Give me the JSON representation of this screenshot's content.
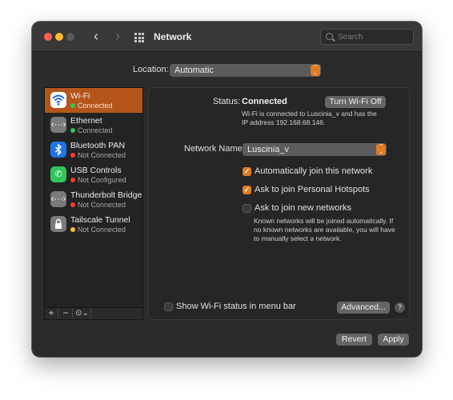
{
  "titlebar": {
    "title": "Network",
    "search_placeholder": "Search"
  },
  "location": {
    "label": "Location:",
    "value": "Automatic"
  },
  "services": [
    {
      "name": "Wi-Fi",
      "status": "Connected",
      "status_color": "#30c75a",
      "icon": "wifi-icon",
      "icon_bg": "#1f6fe0"
    },
    {
      "name": "Ethernet",
      "status": "Connected",
      "status_color": "#30c75a",
      "icon": "ethernet-icon",
      "icon_bg": "#7a7a7a"
    },
    {
      "name": "Bluetooth PAN",
      "status": "Not Connected",
      "status_color": "#ff3b30",
      "icon": "bluetooth-icon",
      "icon_bg": "#1e74e8"
    },
    {
      "name": "USB Controls",
      "status": "Not Configured",
      "status_color": "#ff3b30",
      "icon": "phone-icon",
      "icon_bg": "#2ec55a"
    },
    {
      "name": "Thunderbolt Bridge",
      "status": "Not Connected",
      "status_color": "#ff3b30",
      "icon": "thunderbolt-bridge-icon",
      "icon_bg": "#7a7a7a"
    },
    {
      "name": "Tailscale Tunnel",
      "status": "Not Connected",
      "status_color": "#febc2e",
      "icon": "lock-icon",
      "icon_bg": "#7a7a7a"
    }
  ],
  "sidebar_controls": {
    "add": "+",
    "remove": "−",
    "action": "⊙⌄"
  },
  "detail": {
    "status_label": "Status:",
    "status_value": "Connected",
    "turn_off_button": "Turn Wi-Fi Off",
    "status_desc_1": "Wi-Fi is connected to Luscinia_v and has the",
    "status_desc_2": "IP address 192.168.68.146.",
    "network_name_label": "Network Name:",
    "network_name_value": "Luscinia_v",
    "auto_join_label": "Automatically join this network",
    "hotspots_label": "Ask to join Personal Hotspots",
    "new_networks_label": "Ask to join new networks",
    "new_networks_desc_1": "Known networks will be joined automatically. If",
    "new_networks_desc_2": "no known networks are available, you will have",
    "new_networks_desc_3": "to manually select a network.",
    "menu_bar_label": "Show Wi-Fi status in menu bar",
    "advanced_button": "Advanced...",
    "help": "?"
  },
  "footer": {
    "revert": "Revert",
    "apply": "Apply"
  },
  "colors": {
    "accent": "#e07b26",
    "selection": "#b4561c"
  }
}
